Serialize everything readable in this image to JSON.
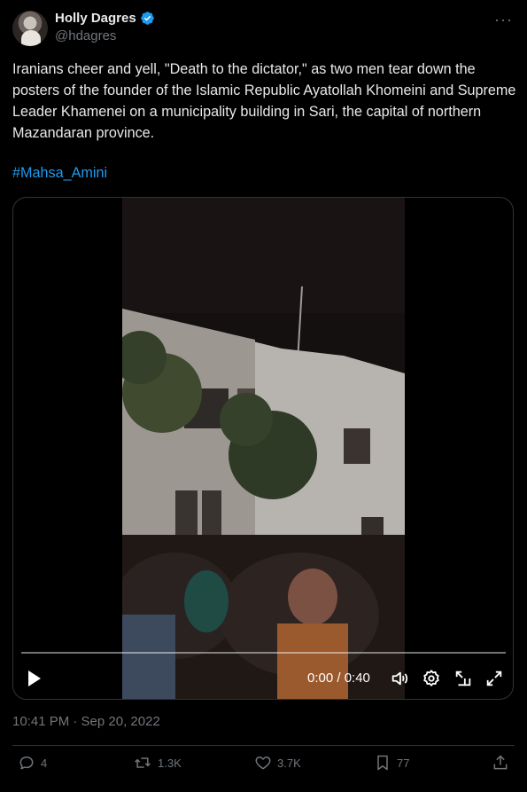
{
  "author": {
    "display_name": "Holly Dagres",
    "handle": "@hdagres",
    "verified": true
  },
  "more_icon": "ellipsis-icon",
  "tweet": {
    "text": "Iranians cheer and yell, \"Death to the dictator,\" as two men tear down the posters of the founder of the Islamic Republic Ayatollah Khomeini and Supreme Leader Khamenei on a municipality building in Sari, the capital of northern Mazandaran province.",
    "hashtag": "#Mahsa_Amini",
    "timestamp": "10:41 PM · Sep 20, 2022"
  },
  "video": {
    "time_display": "0:00 / 0:40",
    "progress": 0.0
  },
  "actions": {
    "replies": "4",
    "reposts": "1.3K",
    "likes": "3.7K",
    "bookmarks": "77"
  },
  "colors": {
    "background": "#000000",
    "text": "#e7e9ea",
    "muted": "#71767b",
    "link": "#1d9bf0",
    "border": "#2f3336"
  }
}
